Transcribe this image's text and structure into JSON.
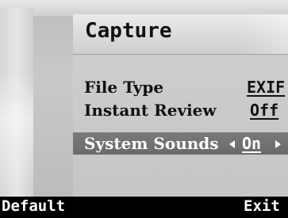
{
  "screen": {
    "title": "Capture"
  },
  "settings": [
    {
      "label": "File Type",
      "value": "EXIF",
      "selected": false
    },
    {
      "label": "Instant Review",
      "value": "Off",
      "selected": false
    },
    {
      "label": "System Sounds",
      "value": "On",
      "selected": true
    }
  ],
  "softkeys": {
    "left": "Default",
    "right": "Exit"
  },
  "colors": {
    "selected_row": "#6e6e6e",
    "background": "#c8c8c8",
    "softbar": "#000000"
  },
  "icons": {
    "selected_left_arrow": "left-arrow-icon",
    "selected_right_arrow": "right-arrow-icon"
  }
}
